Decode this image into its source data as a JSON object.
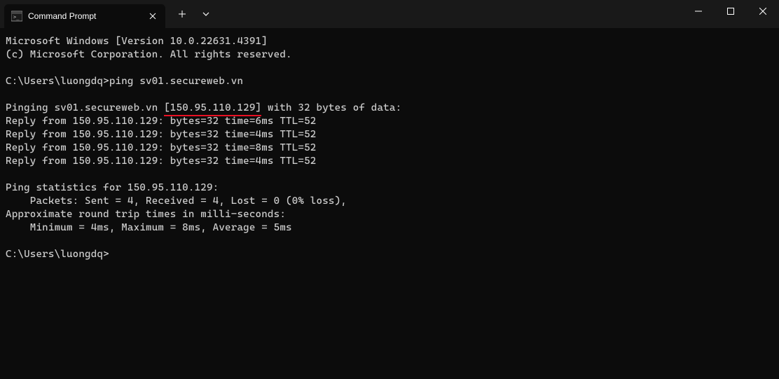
{
  "titlebar": {
    "tab_title": "Command Prompt",
    "new_tab_icon": "+",
    "dropdown_icon": "⌄"
  },
  "terminal": {
    "line1": "Microsoft Windows [Version 10.0.22631.4391]",
    "line2": "(c) Microsoft Corporation. All rights reserved.",
    "blank1": "",
    "prompt1_path": "C:\\Users\\luongdq>",
    "prompt1_cmd": "ping sv01.secureweb.vn",
    "blank2": "",
    "ping_header_pre": "Pinging sv01.secureweb.vn ",
    "ping_header_ip": "[150.95.110.129]",
    "ping_header_post": " with 32 bytes of data:",
    "reply1": "Reply from 150.95.110.129: bytes=32 time=6ms TTL=52",
    "reply2": "Reply from 150.95.110.129: bytes=32 time=4ms TTL=52",
    "reply3": "Reply from 150.95.110.129: bytes=32 time=8ms TTL=52",
    "reply4": "Reply from 150.95.110.129: bytes=32 time=4ms TTL=52",
    "blank3": "",
    "stats_header": "Ping statistics for 150.95.110.129:",
    "stats_packets": "    Packets: Sent = 4, Received = 4, Lost = 0 (0% loss),",
    "stats_rtt_header": "Approximate round trip times in milli-seconds:",
    "stats_rtt": "    Minimum = 4ms, Maximum = 8ms, Average = 5ms",
    "blank4": "",
    "prompt2_path": "C:\\Users\\luongdq>"
  }
}
